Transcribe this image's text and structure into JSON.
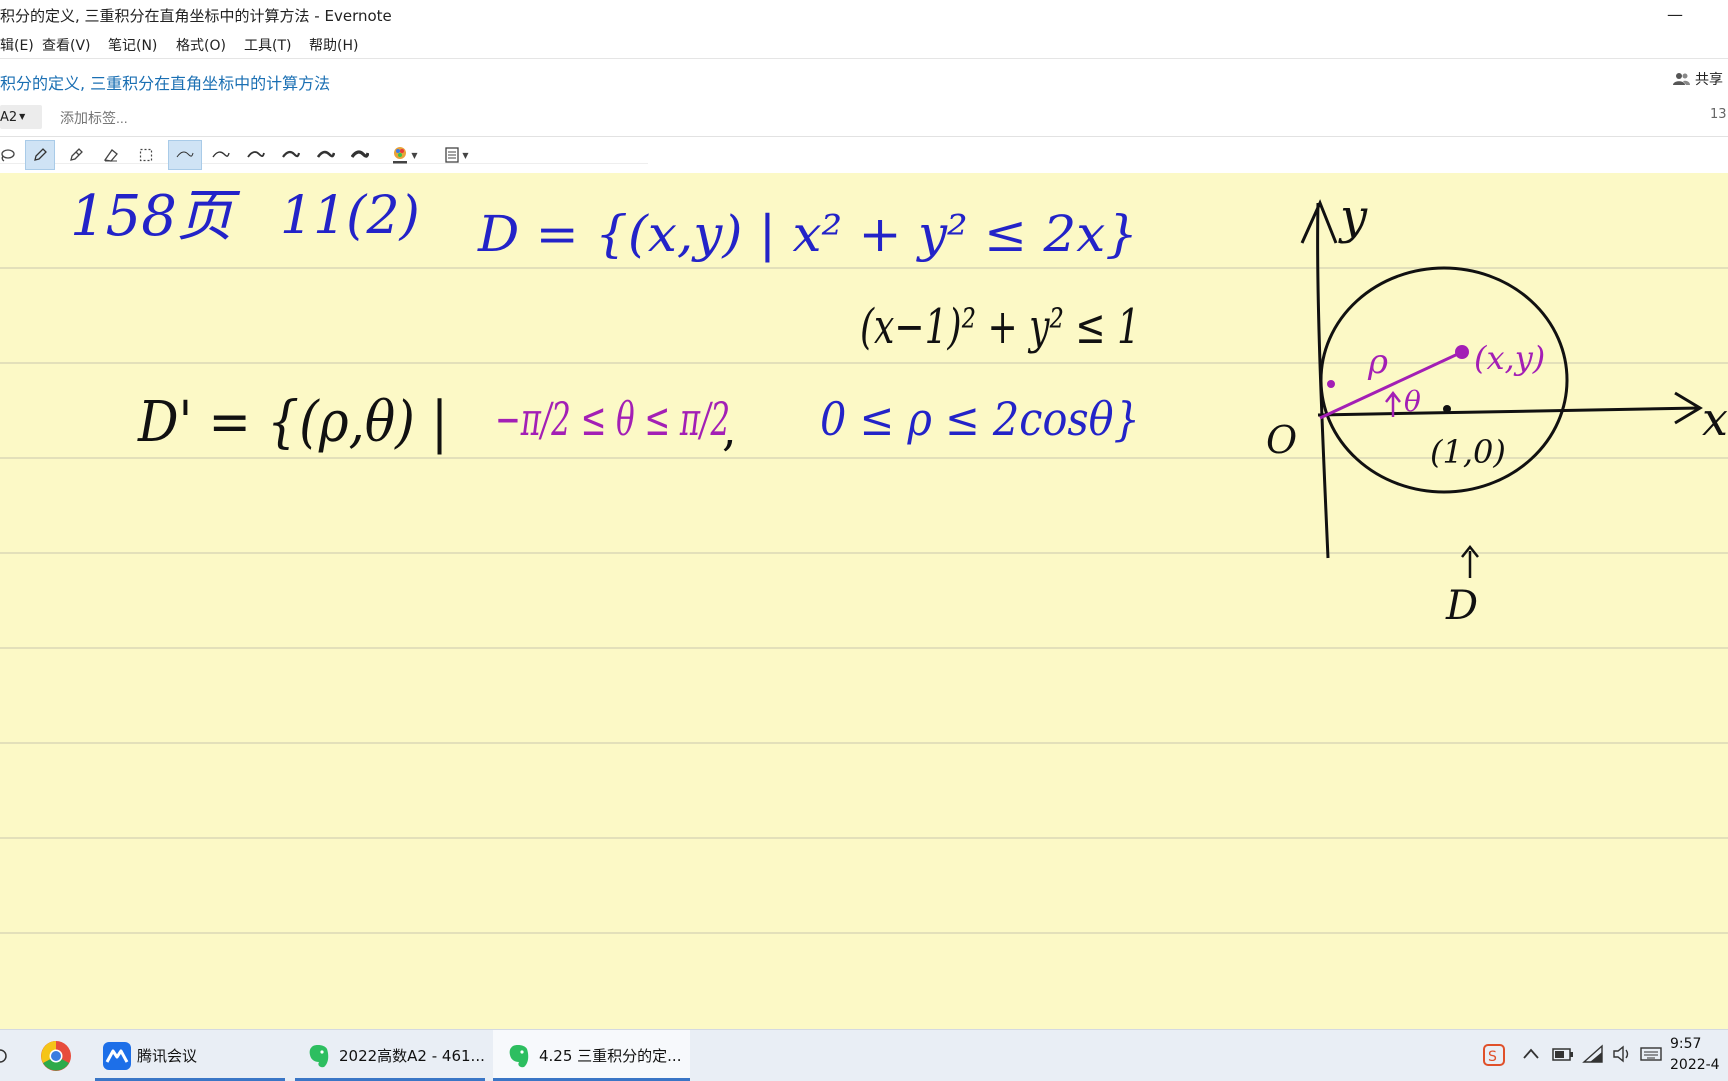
{
  "window": {
    "title": "积分的定义, 三重积分在直角坐标中的计算方法 - Evernote",
    "minimize_glyph": "—"
  },
  "menu": [
    "辑(E)",
    "查看(V)",
    "笔记(N)",
    "格式(O)",
    "工具(T)",
    "帮助(H)"
  ],
  "note": {
    "title": "积分的定义, 三重积分在直角坐标中的计算方法",
    "share_label": "共享",
    "notebook": "A2",
    "tag_placeholder": "添加标签...",
    "page_count": "13"
  },
  "toolbar": {
    "tools": [
      "lasso-icon",
      "pen-icon",
      "highlighter-icon",
      "eraser-icon",
      "selection-icon",
      "stroke-1-icon",
      "stroke-2-icon",
      "stroke-3-icon",
      "stroke-4-icon",
      "stroke-5-icon",
      "stroke-6-icon",
      "color-picker-icon",
      "paper-style-icon"
    ],
    "active_tools": [
      "pen-icon",
      "stroke-1-icon"
    ]
  },
  "handwriting": {
    "line1": {
      "page_ref": "158页",
      "problem": "11(2)",
      "set_def": "D = {(x,y) | x² + y² ≤ 2x}",
      "rewritten": "(x−1)² + y² ≤ 1"
    },
    "line2": {
      "set_def": "D' = {(ρ,θ) |",
      "theta_range": "−π/2 ≤ θ ≤ π/2",
      "rho_range": "0 ≤ ρ ≤ 2cosθ}"
    },
    "diagram": {
      "x_axis_label": "x",
      "y_axis_label": "y",
      "origin_label": "O",
      "point_label": "(x,y)",
      "rho_label": "ρ",
      "theta_label": "θ",
      "center_label": "(1,0)",
      "region_label": "D"
    },
    "colors": {
      "blue": "#2323c8",
      "purple": "#a31fb5",
      "black": "#111111"
    }
  },
  "taskbar": {
    "tasks": [
      {
        "label": "",
        "icon": "chrome-icon"
      },
      {
        "label": "腾讯会议",
        "icon": "tencent-meeting-icon"
      },
      {
        "label": "2022高数A2 - 461...",
        "icon": "evernote-icon"
      },
      {
        "label": "4.25 三重积分的定...",
        "icon": "evernote-icon"
      }
    ],
    "tray": [
      "sogou-ime-icon",
      "chevron-up-icon",
      "battery-icon",
      "wifi-icon",
      "volume-icon",
      "keyboard-icon"
    ],
    "time": "9:57",
    "date": "2022-4"
  }
}
